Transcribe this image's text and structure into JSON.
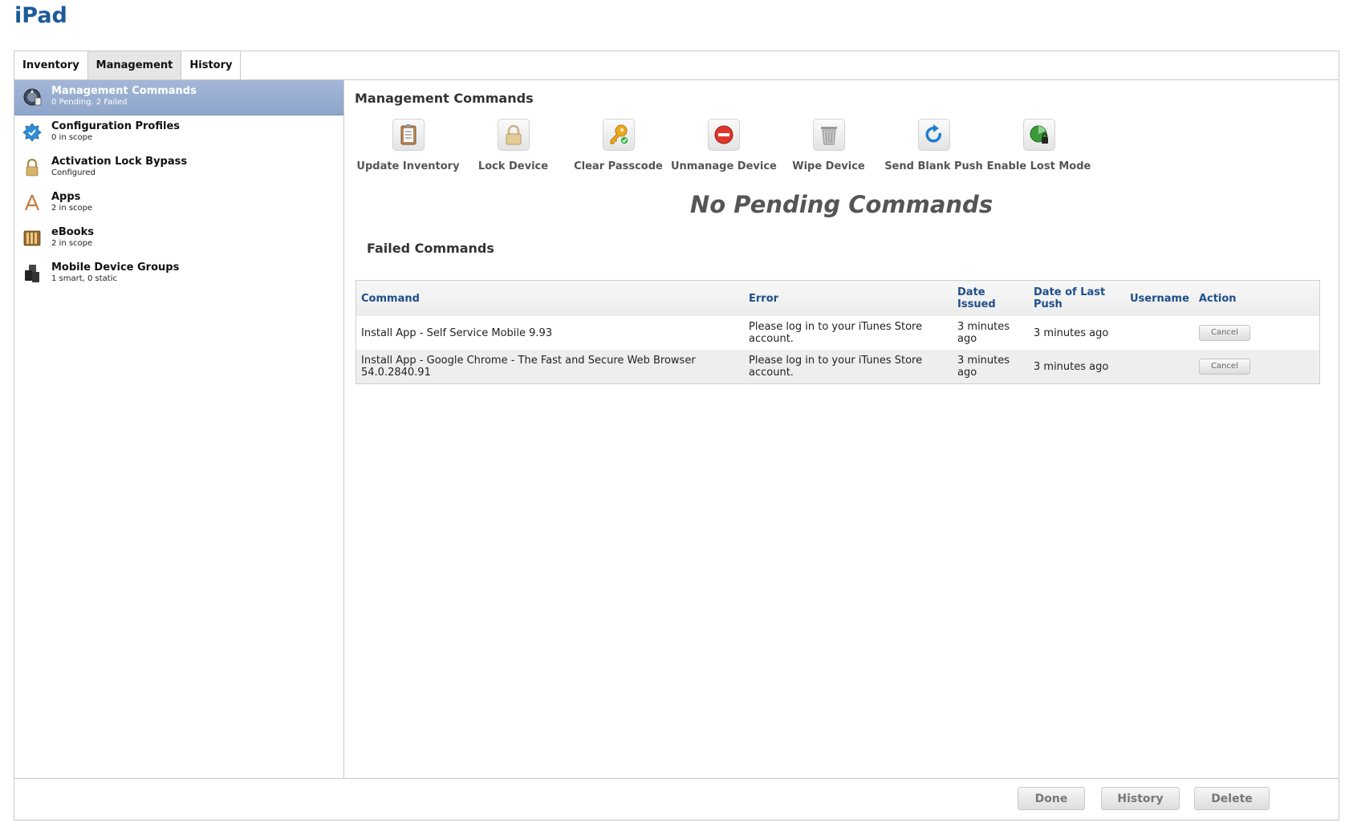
{
  "page": {
    "title": "iPad"
  },
  "tabs": [
    {
      "label": "Inventory",
      "active": false
    },
    {
      "label": "Management",
      "active": true
    },
    {
      "label": "History",
      "active": false
    }
  ],
  "sidebar": {
    "items": [
      {
        "title": "Management Commands",
        "subtitle": "0 Pending, 2 Failed",
        "icon": "management-commands-icon",
        "selected": true
      },
      {
        "title": "Configuration Profiles",
        "subtitle": "0 in scope",
        "icon": "configuration-profile-icon",
        "selected": false
      },
      {
        "title": "Activation Lock Bypass",
        "subtitle": "Configured",
        "icon": "lock-icon",
        "selected": false
      },
      {
        "title": "Apps",
        "subtitle": "2 in scope",
        "icon": "app-store-icon",
        "selected": false
      },
      {
        "title": "eBooks",
        "subtitle": "2 in scope",
        "icon": "ebook-icon",
        "selected": false
      },
      {
        "title": "Mobile Device Groups",
        "subtitle": "1 smart, 0 static",
        "icon": "device-group-icon",
        "selected": false
      }
    ]
  },
  "main": {
    "section_title": "Management Commands",
    "commands": [
      {
        "label": "Update Inventory",
        "icon": "clipboard-icon"
      },
      {
        "label": "Lock Device",
        "icon": "padlock-icon"
      },
      {
        "label": "Clear Passcode",
        "icon": "key-icon"
      },
      {
        "label": "Unmanage Device",
        "icon": "no-entry-icon"
      },
      {
        "label": "Wipe Device",
        "icon": "trash-icon"
      },
      {
        "label": "Send Blank Push",
        "icon": "refresh-icon"
      },
      {
        "label": "Enable Lost Mode",
        "icon": "lost-mode-icon"
      }
    ],
    "no_pending": "No Pending Commands",
    "failed_title": "Failed Commands",
    "failed_table": {
      "headers": [
        "Command",
        "Error",
        "Date Issued",
        "Date of Last Push",
        "Username",
        "Action"
      ],
      "rows": [
        {
          "command": "Install App - Self Service Mobile 9.93",
          "error": "Please log in to your iTunes Store account.",
          "date_issued": "3 minutes ago",
          "last_push": "3 minutes ago",
          "username": "",
          "action": "Cancel"
        },
        {
          "command": "Install App - Google Chrome - The Fast and Secure Web Browser 54.0.2840.91",
          "error": "Please log in to your iTunes Store account.",
          "date_issued": "3 minutes ago",
          "last_push": "3 minutes ago",
          "username": "",
          "action": "Cancel"
        }
      ]
    }
  },
  "footer": {
    "done": "Done",
    "history": "History",
    "delete": "Delete"
  },
  "colors": {
    "accent": "#1e5a9a",
    "selected_row": "#99aed3",
    "header_text": "#1e4f8a"
  }
}
